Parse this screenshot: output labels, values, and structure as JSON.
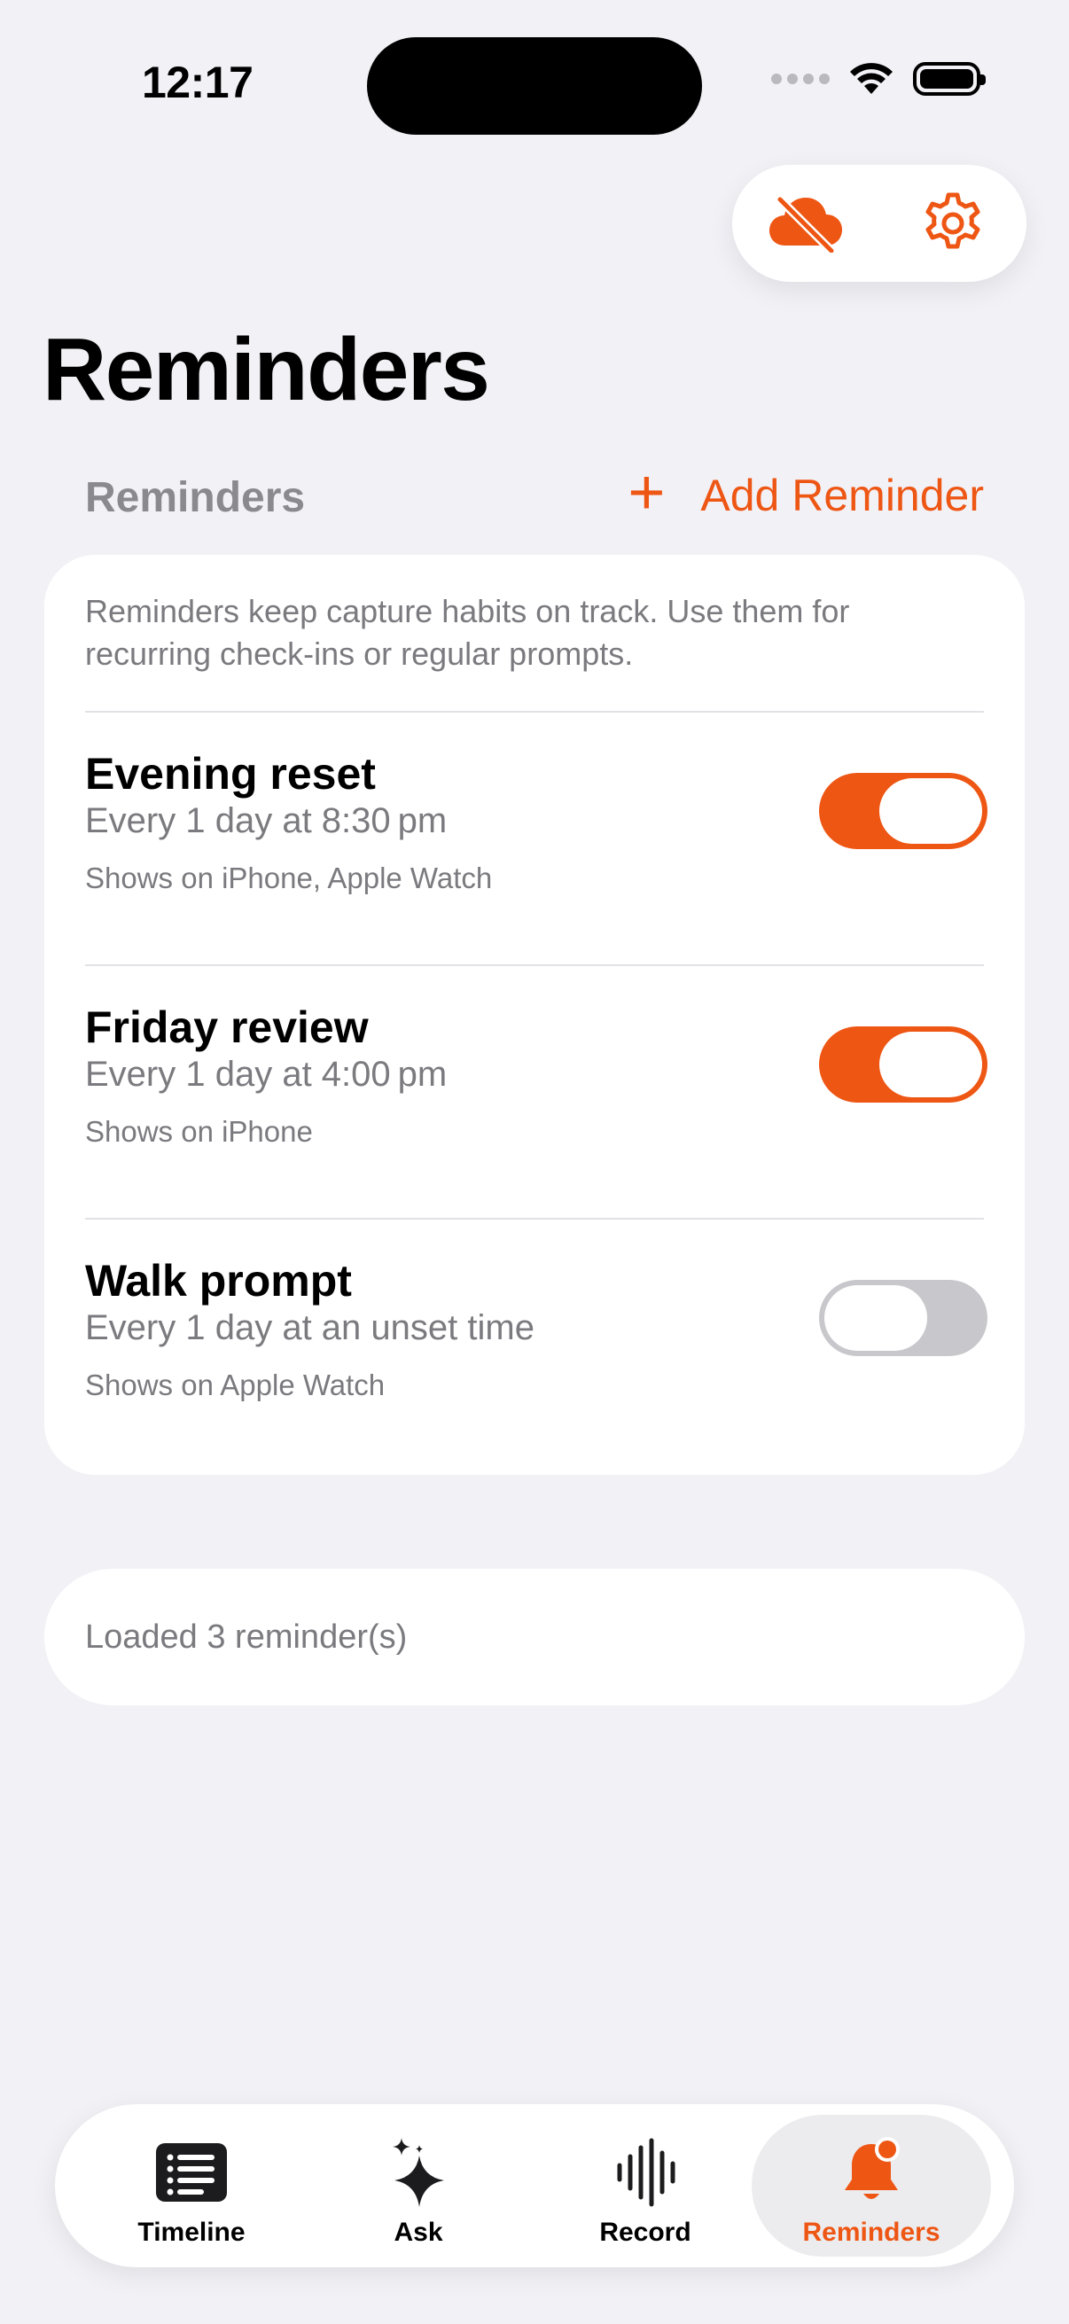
{
  "status_bar": {
    "time": "12:17"
  },
  "colors": {
    "accent": "#EE5614",
    "toggle_off": "#C8C8CC",
    "background": "#F2F1F6"
  },
  "top_actions": {
    "sync_icon": "cloud-slash-icon",
    "settings_icon": "gear-icon"
  },
  "page": {
    "title": "Reminders"
  },
  "section": {
    "header": "Reminders",
    "add_label": "Add Reminder"
  },
  "card": {
    "description": "Reminders keep capture habits on track. Use them for recurring check-ins or regular prompts.",
    "reminders": [
      {
        "title": "Evening reset",
        "schedule": "Every 1 day at 8:30 pm",
        "devices": "Shows on iPhone, Apple Watch",
        "enabled": true
      },
      {
        "title": "Friday review",
        "schedule": "Every 1 day at 4:00 pm",
        "devices": "Shows on iPhone",
        "enabled": true
      },
      {
        "title": "Walk prompt",
        "schedule": "Every 1 day at an unset time",
        "devices": "Shows on Apple Watch",
        "enabled": false
      }
    ]
  },
  "status": {
    "text": "Loaded 3 reminder(s)"
  },
  "tabbar": {
    "tabs": [
      {
        "label": "Timeline",
        "icon": "list-icon"
      },
      {
        "label": "Ask",
        "icon": "sparkles-icon"
      },
      {
        "label": "Record",
        "icon": "waveform-icon"
      },
      {
        "label": "Reminders",
        "icon": "bell-badge-icon",
        "active": true
      }
    ]
  }
}
